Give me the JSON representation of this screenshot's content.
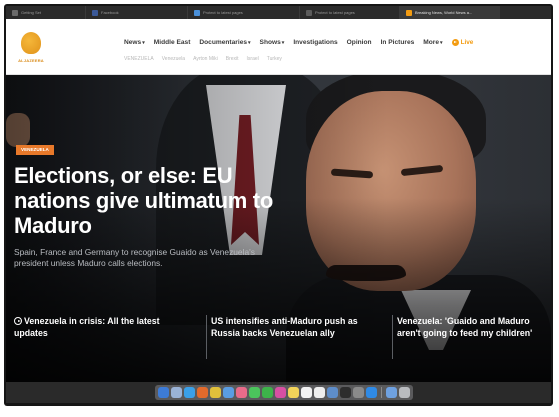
{
  "tabs": [
    {
      "label": "Getting Set",
      "favicon_color": "#6b6b6b",
      "active": false
    },
    {
      "label": "Facebook",
      "favicon_color": "#3b5998",
      "active": false
    },
    {
      "label": "Protect to latest pages",
      "favicon_color": "#4a90d9",
      "active": false
    },
    {
      "label": "Protect to latest pages",
      "favicon_color": "#5c5c5c",
      "active": false
    },
    {
      "label": "Breaking News, World News a...",
      "favicon_color": "#f39c12",
      "active": true
    }
  ],
  "site": {
    "logo_text": "ALJAZEERA",
    "brand_color": "#e0921a"
  },
  "nav": {
    "items": [
      {
        "label": "News",
        "caret": "▾"
      },
      {
        "label": "Middle East",
        "caret": ""
      },
      {
        "label": "Documentaries",
        "caret": "▾"
      },
      {
        "label": "Shows",
        "caret": "▾"
      },
      {
        "label": "Investigations",
        "caret": ""
      },
      {
        "label": "Opinion",
        "caret": ""
      },
      {
        "label": "In Pictures",
        "caret": ""
      },
      {
        "label": "More",
        "caret": "▾"
      }
    ],
    "live_label": "Live",
    "live_color": "#f39c12"
  },
  "subnav": {
    "items": [
      "VENEZUELA",
      "Venezuela",
      "Ayrton Miki",
      "Brexit",
      "Israel",
      "Turkey"
    ]
  },
  "hero": {
    "badge": "VENEZUELA",
    "badge_color": "#e8792a",
    "headline": "Elections, or else: EU nations give ultimatum to Maduro",
    "summary": "Spain, France and Germany to recognise Guaido as Venezuela's president unless Maduro calls elections."
  },
  "related": [
    {
      "label": "Venezuela in crisis: All the latest updates",
      "icon": "play-circle-icon"
    },
    {
      "label": "US intensifies anti-Maduro push as Russia backs Venezuelan ally",
      "icon": ""
    },
    {
      "label": "Venezuela: 'Guaido and Maduro aren't going to feed my children'",
      "icon": ""
    }
  ],
  "dock": {
    "icons": [
      {
        "name": "finder-icon",
        "color": "#3d7bd6"
      },
      {
        "name": "launchpad-icon",
        "color": "#9ab3d6"
      },
      {
        "name": "safari-icon",
        "color": "#3aa0e8"
      },
      {
        "name": "firefox-icon",
        "color": "#e26a2c"
      },
      {
        "name": "chrome-icon",
        "color": "#e0c03b"
      },
      {
        "name": "mail-icon",
        "color": "#5a9de3"
      },
      {
        "name": "photos-icon",
        "color": "#e86b8a"
      },
      {
        "name": "messages-icon",
        "color": "#4bc45c"
      },
      {
        "name": "facetime-icon",
        "color": "#3db34a"
      },
      {
        "name": "itunes-icon",
        "color": "#d84fa3"
      },
      {
        "name": "notes-icon",
        "color": "#f1d35a"
      },
      {
        "name": "reminders-icon",
        "color": "#f2f2f2"
      },
      {
        "name": "calendar-icon",
        "color": "#eeeeee"
      },
      {
        "name": "preview-icon",
        "color": "#5e8dc9"
      },
      {
        "name": "terminal-icon",
        "color": "#2d2d2d"
      },
      {
        "name": "system-prefs-icon",
        "color": "#8a8a8a"
      },
      {
        "name": "app-store-icon",
        "color": "#2f8ae6"
      }
    ],
    "trailing": [
      {
        "name": "downloads-icon",
        "color": "#6fa1e0"
      },
      {
        "name": "trash-icon",
        "color": "#b9bbbf"
      }
    ]
  }
}
